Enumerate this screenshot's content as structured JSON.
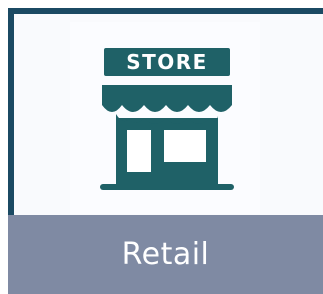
{
  "tile": {
    "label": "Retail",
    "icon": {
      "name": "store-icon",
      "sign_text": "STORE"
    }
  },
  "colors": {
    "frame": "#1b4a63",
    "icon": "#1f6167",
    "label_bar": "#7f8aa3",
    "label_text": "#ffffff"
  }
}
